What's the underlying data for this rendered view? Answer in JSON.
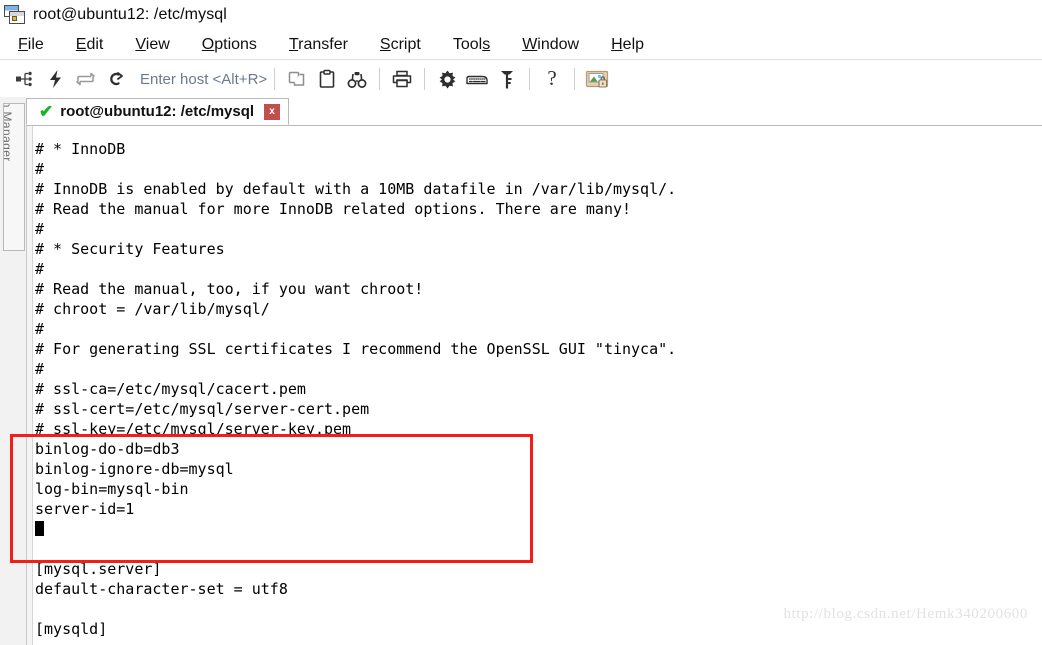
{
  "window": {
    "title": "root@ubuntu12: /etc/mysql",
    "icon": "cascading-windows-icon"
  },
  "menubar": {
    "items": [
      {
        "mnemonic": "F",
        "rest": "ile"
      },
      {
        "mnemonic": "E",
        "rest": "dit"
      },
      {
        "mnemonic": "V",
        "rest": "iew"
      },
      {
        "mnemonic": "O",
        "rest": "ptions"
      },
      {
        "mnemonic": "T",
        "rest": "ransfer"
      },
      {
        "mnemonic": "S",
        "rest": "cript"
      },
      {
        "pre": "Tool",
        "mnemonic": "s",
        "rest": ""
      },
      {
        "mnemonic": "W",
        "rest": "indow"
      },
      {
        "mnemonic": "H",
        "rest": "elp"
      }
    ]
  },
  "toolbar": {
    "host_placeholder": "Enter host <Alt+R>",
    "buttons": [
      "session-manager-icon",
      "quick-connect-icon",
      "reconnect-icon",
      "disconnect-icon",
      "copy-icon",
      "paste-icon",
      "find-icon",
      "print-icon",
      "settings-gear-icon",
      "keyboard-icon",
      "key-icon",
      "help-icon",
      "ssh-security-icon"
    ]
  },
  "sessionbar": {
    "label": "Session Manager"
  },
  "tab": {
    "label": "root@ubuntu12: /etc/mysql",
    "status": "connected",
    "close_label": "x"
  },
  "terminal": {
    "lines": [
      "# * InnoDB",
      "#",
      "# InnoDB is enabled by default with a 10MB datafile in /var/lib/mysql/.",
      "# Read the manual for more InnoDB related options. There are many!",
      "#",
      "# * Security Features",
      "#",
      "# Read the manual, too, if you want chroot!",
      "# chroot = /var/lib/mysql/",
      "#",
      "# For generating SSL certificates I recommend the OpenSSL GUI \"tinyca\".",
      "#",
      "# ssl-ca=/etc/mysql/cacert.pem",
      "# ssl-cert=/etc/mysql/server-cert.pem",
      "# ssl-key=/etc/mysql/server-key.pem",
      "binlog-do-db=db3",
      "binlog-ignore-db=mysql",
      "log-bin=mysql-bin",
      "server-id=1",
      "",
      "",
      "[mysql.server]",
      "default-character-set = utf8",
      "",
      "[mysqld]"
    ],
    "cursor_line_index": 19
  },
  "annotation": {
    "box_color": "#f51d18",
    "highlighted_lines": [
      "binlog-do-db=db3",
      "binlog-ignore-db=mysql",
      "log-bin=mysql-bin",
      "server-id=1"
    ]
  },
  "watermark": {
    "text": "http://blog.csdn.net/Hemk340200600"
  }
}
